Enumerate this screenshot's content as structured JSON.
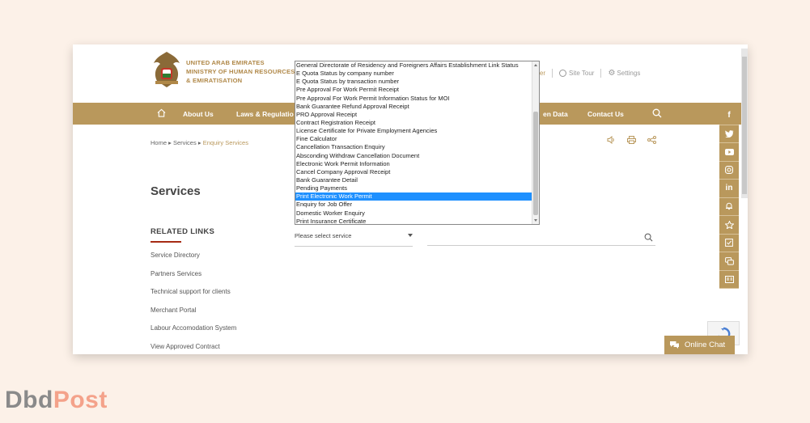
{
  "header": {
    "org_line1": "UNITED ARAB EMIRATES",
    "org_line2": "MINISTRY OF HUMAN RESOURCES",
    "org_line3": "& EMIRATISATION",
    "register": "egister",
    "site_tour": "Site Tour",
    "settings": "Settings"
  },
  "nav": {
    "about": "About Us",
    "laws": "Laws & Regulatio",
    "open_data": "en Data",
    "contact": "Contact Us"
  },
  "breadcrumb": {
    "home": "Home",
    "services": "Services",
    "current": "Enquiry Services"
  },
  "page_title": "Services",
  "related": {
    "title": "RELATED LINKS",
    "links": [
      "Service Directory",
      "Partners Services",
      "Technical support for clients",
      "Merchant Portal",
      "Labour Accomodation System",
      "View Approved Contract"
    ]
  },
  "service_select": {
    "placeholder": "Please select service",
    "selected_index": 16,
    "options": [
      "General Directorate of Residency and Foreigners Affairs Establishment Link Status",
      "E Quota Status by company number",
      "E Quota Status by transaction number",
      "Pre Approval For Work Permit Receipt",
      "Pre Approval For Work Permit Information Status for MOI",
      "Bank Guarantee Refund Approval Receipt",
      "PRO Approval Receipt",
      "Contract Registration Receipt",
      "License Certificate for Private Employment Agencies",
      "Fine Calculator",
      "Cancellation Transaction Enquiry",
      "Absconding Withdraw Cancellation Document",
      "Electronic Work Permit Information",
      "Cancel Company Approval Receipt",
      "Bank Guarantee Detail",
      "Pending Payments",
      "Print Electronic Work Permit",
      "Enquiry for Job Offer",
      "Domestic Worker Enquiry",
      "Print Insurance Certificate"
    ]
  },
  "social": {
    "facebook": "f",
    "linkedin": "in"
  },
  "chat": {
    "label": "Online Chat"
  },
  "watermark": {
    "part1": "Dbd",
    "part2": "Post"
  },
  "colors": {
    "gold": "#b9985c",
    "red_accent": "#a62b14",
    "selected": "#1e90ff"
  }
}
